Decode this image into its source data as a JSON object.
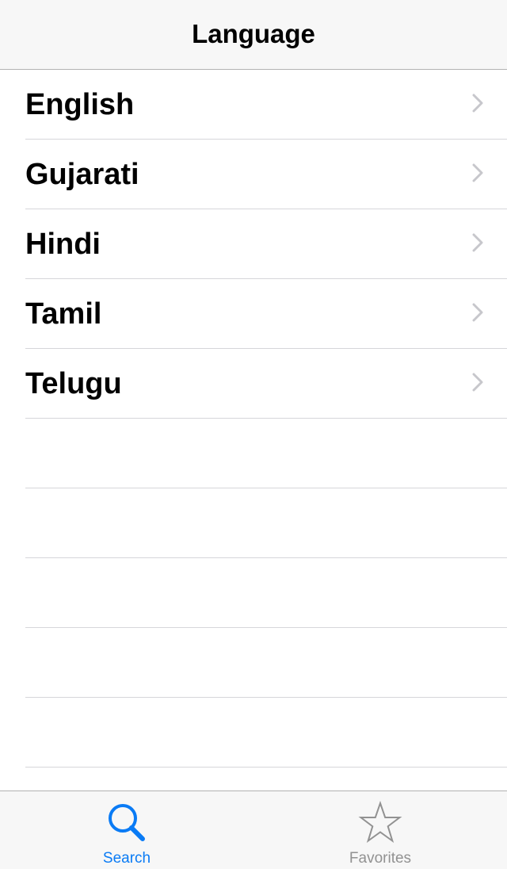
{
  "navbar": {
    "title": "Language"
  },
  "languages": [
    {
      "label": "English"
    },
    {
      "label": "Gujarati"
    },
    {
      "label": "Hindi"
    },
    {
      "label": "Tamil"
    },
    {
      "label": "Telugu"
    }
  ],
  "tabbar": {
    "tabs": [
      {
        "label": "Search",
        "icon": "search-icon",
        "selected": true
      },
      {
        "label": "Favorites",
        "icon": "star-icon",
        "selected": false
      }
    ]
  },
  "colors": {
    "accent": "#0a7bf5",
    "inactive": "#929292",
    "separator": "#d6d6da",
    "bar_background": "#f7f7f7"
  }
}
